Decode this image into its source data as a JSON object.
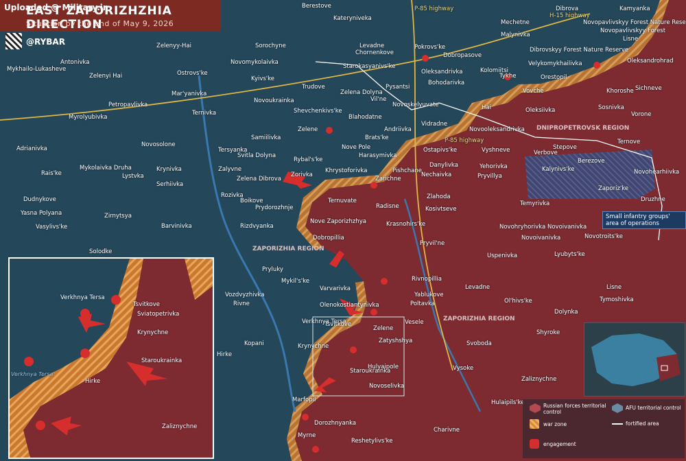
{
  "header": {
    "title": "EAST ZAPORIZHZHIA DIRECTION",
    "subtitle": "Situation by the end of May 9, 2026",
    "uploaded": "Uploaded @ Military.ir",
    "brand": "@RYBAR"
  },
  "colors": {
    "afu": "#24475a",
    "russian": "#7d2a30",
    "warzone": "#d98a35",
    "fortified": "#ffffff",
    "engagement": "#d62d2d",
    "infantry": "#2c4f86"
  },
  "regions": {
    "zap_north": "ZAPORIZHIA REGION",
    "zap_south": "ZAPORIZHIA REGION",
    "dnipro": "DNIPROPETROVSK REGION"
  },
  "roads": {
    "p85_top": "P-85 highway",
    "h15": "H-15 highway",
    "p85_mid": "P-85 highway"
  },
  "reserves": {
    "novopavlivsky": "Novopavlivskyy Forest Nature Reserve",
    "dibrovsky": "Dibrovskyy Forest Nature Reserve"
  },
  "callout": "Small infantry groups' area of operations",
  "settlements": [
    "Berestove",
    "Dibrova",
    "Kamyanka",
    "Kateryniveka",
    "Mechetne",
    "Novopavlivskyy Forest",
    "Zelenyy-Hai",
    "Sorochyne",
    "Levadne",
    "Chornenkove",
    "Pokrovs'ke",
    "Malynivka",
    "Lisne",
    "Mykhailo-Lukasheve",
    "Antonivka",
    "Novomykolaivka",
    "Starokasyanivs'ke",
    "Dobropasove",
    "Oleksandrivka",
    "Kolomiitsi",
    "Velykomykhailivka",
    "Oleksandrohrad",
    "Zelenyi Hai",
    "Ostrovs'ke",
    "Kyivs'ke",
    "Trudove",
    "Pysantsi",
    "Bohodarivka",
    "Orestopil",
    "Tykhe",
    "Vovche",
    "Khoroshe",
    "Sichneve",
    "Mar'yanivka",
    "Zelena Dolyna",
    "Vil'ne",
    "Novoskelyuvate",
    "Hai",
    "Oleksiivka",
    "Sosnivka",
    "Petropavlivka",
    "Novoukrainka",
    "Shevchenkivs'ke",
    "Blahodatne",
    "Myrolyubivka",
    "Ternivka",
    "Zelene",
    "Andriivka",
    "Vidradne",
    "Novooleksandrivka",
    "Vorone",
    "Adrianivka",
    "Novosolone",
    "Samiilivka",
    "Nove Pole",
    "Brats'ke",
    "Ostapivs'ke",
    "Vyshneve",
    "Verbove",
    "Stepove",
    "Ternove",
    "Mykolaivka Druha",
    "Tersyanka",
    "Svitla Dolyna",
    "Rybal's'ke",
    "Harasymivka",
    "Danylivka",
    "Yehorivka",
    "Berezove",
    "Novohearhiivka",
    "Krynivka",
    "Zalyvne",
    "Khrystoforivka",
    "Pishchane",
    "Kalynivs'ke",
    "Rais'ke",
    "Lystvka",
    "Serhiivka",
    "Zelena Dibrova",
    "Zorivka",
    "Zarichne",
    "Nechaivka",
    "Pryvillya",
    "Zaporiz'ke",
    "Dudnykove",
    "Rozivka",
    "Boikove",
    "Ternuvate",
    "Radisne",
    "Zlahoda",
    "Temyrivka",
    "Druzhne",
    "Yasna Polyana",
    "Zirnytsya",
    "Prydorozhnje",
    "Nove Zaporizhzhya",
    "Kosivtseve",
    "Krasnohirs'ke",
    "Novohryhorivka",
    "Novoivanivka",
    "Vasylivs'ke",
    "Barvinivka",
    "Rizdvyanka",
    "Dobropillia",
    "Pryvil'ne",
    "Novoivanivka",
    "Novotroits'ke",
    "Solodke",
    "Uspenivka",
    "Lyubyts'ke",
    "Pryluky",
    "Rivnopillia",
    "Levadne",
    "Lisne",
    "Mykil's'ke",
    "Vozdvyzhivka",
    "Varvarivka",
    "Yablukove",
    "Ol'hivs'ke",
    "Tymoshivka",
    "Rivne",
    "Olenokostiantynivka",
    "Poltavka",
    "Dolynka",
    "Verkhnya Tersa",
    "Tsvitkove",
    "Zelene",
    "Veselе",
    "Shyroke",
    "Kopani",
    "Krynychne",
    "Zatyshshya",
    "Svoboda",
    "Hirke",
    "Staroukrainka",
    "Hulyaipole",
    "Vysoke",
    "Zaliznychne",
    "Novoselivka",
    "Marfopil",
    "Hulaipils'ke",
    "Dorozhnyanka",
    "Charivne",
    "Myrne",
    "Reshetylivs'ke"
  ],
  "inset": {
    "labels": [
      "Verkhnya Tersa",
      "Tsvitkove",
      "Sviatopetrivka",
      "Krynychne",
      "Staroukrainka",
      "Verkhnya Tersa",
      "Hirke",
      "Zaliznychne"
    ]
  },
  "legend": {
    "ru_control": "Russian forces territorial control",
    "afu_control": "AFU territorial control",
    "war_zone": "war zone",
    "fortified": "fortified area",
    "engagement": "engagement"
  }
}
